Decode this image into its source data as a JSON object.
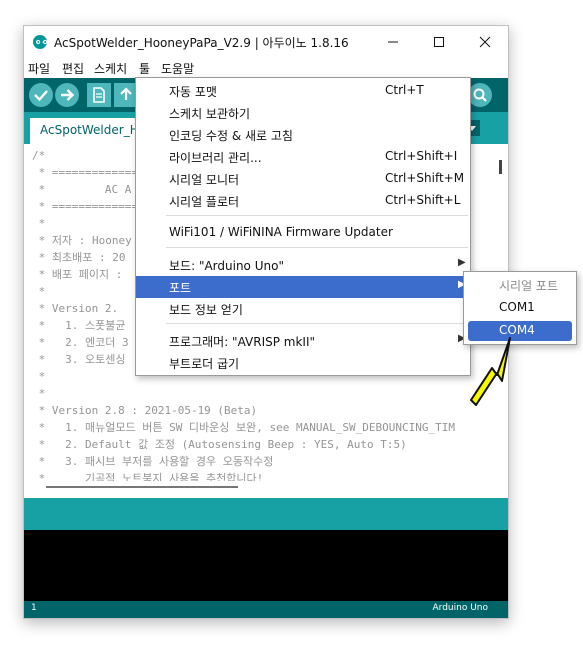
{
  "window": {
    "title": "AcSpotWelder_HooneyPaPa_V2.9 | 아두이노 1.8.16",
    "icon": "arduino-logo-icon",
    "controls": [
      "minimize-icon",
      "maximize-icon",
      "close-icon"
    ]
  },
  "menubar": [
    "파일",
    "편집",
    "스케치",
    "툴",
    "도움말"
  ],
  "toolbar": {
    "buttons": [
      "verify-icon",
      "upload-icon",
      "new-icon",
      "open-icon",
      "serial-monitor-icon"
    ]
  },
  "tab": {
    "label": "AcSpotWelder_H"
  },
  "editor": {
    "lines": [
      "/*",
      " * ==============",
      " *         AC A",
      " * ==============",
      " *",
      " * 저자 : Hooney",
      " * 최초배포 : 20",
      " * 배포 페이지 :",
      " *",
      " * Version 2.",
      " *   1. 스폿불균",
      " *   2. 엔코더 3",
      " *   3. 오토센싱",
      " *",
      " *",
      " * Version 2.8 : 2021-05-19 (Beta)",
      " *   1. 매뉴얼모드 버튼 SW 디바운싱 보완, see MANUAL_SW_DEBOUNCING_TIM",
      " *   2. Default 값 조정 (Autosensing Beep : YES, Auto T:5)",
      " *   3. 패시브 부저를 사용할 경우 오동작수정",
      " *      기곡적 노트북지 사용을 추천합니다!"
    ]
  },
  "footer": {
    "line_number": "1",
    "board": "Arduino Uno"
  },
  "tools_menu": {
    "items": [
      {
        "label": "자동 포맷",
        "shortcut": "Ctrl+T"
      },
      {
        "label": "스케치 보관하기",
        "shortcut": ""
      },
      {
        "label": "인코딩 수정 & 새로 고침",
        "shortcut": ""
      },
      {
        "label": "라이브러리 관리...",
        "shortcut": "Ctrl+Shift+I"
      },
      {
        "label": "시리얼 모니터",
        "shortcut": "Ctrl+Shift+M"
      },
      {
        "label": "시리얼 플로터",
        "shortcut": "Ctrl+Shift+L"
      },
      {
        "label": "WiFi101 / WiFiNINA Firmware Updater",
        "shortcut": ""
      },
      {
        "label": "보드: \"Arduino Uno\"",
        "shortcut": ""
      },
      {
        "label": "포트",
        "shortcut": ""
      },
      {
        "label": "보드 정보 얻기",
        "shortcut": ""
      },
      {
        "label": "프로그래머: \"AVRISP mkII\"",
        "shortcut": ""
      },
      {
        "label": "부트로더 굽기",
        "shortcut": ""
      }
    ],
    "active_item": "포트"
  },
  "port_submenu": {
    "header": "시리얼 포트",
    "options": [
      "COM1",
      "COM4"
    ],
    "selected": "COM4"
  },
  "annotation": {
    "type": "arrow",
    "color": "#f7f700",
    "points_to": "COM4"
  },
  "colors": {
    "toolbar": "#006468",
    "tab_bar": "#17a1a5",
    "menu_highlight": "#3c6ccc",
    "console": "#000000"
  }
}
